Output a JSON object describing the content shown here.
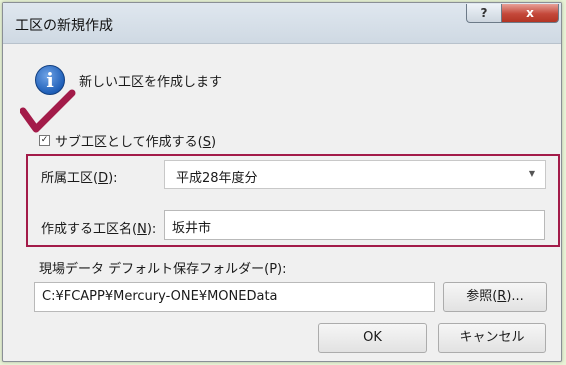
{
  "window": {
    "title": "工区の新規作成",
    "help_label": "?",
    "close_label": "x"
  },
  "info": {
    "icon_letter": "i",
    "message": "新しい工区を作成します"
  },
  "subtask_checkbox": {
    "prefix": "サブ工区として作成する(",
    "key": "S",
    "suffix": ")",
    "checked_glyph": "✓"
  },
  "parent_section": {
    "prefix": "所属工区(",
    "key": "D",
    "suffix": "):",
    "value": "平成28年度分",
    "arrow": "▼"
  },
  "section_name": {
    "prefix": "作成する工区名(",
    "key": "N",
    "suffix": "):",
    "value": "坂井市"
  },
  "default_folder": {
    "label": "現場データ デフォルト保存フォルダー(P):",
    "path": "C:¥FCAPP¥Mercury-ONE¥MONEData"
  },
  "browse_button": {
    "prefix": "参照(",
    "key": "R",
    "suffix": ")..."
  },
  "ok_button": {
    "label": "OK"
  },
  "cancel_button": {
    "label": "キャンセル"
  },
  "accent_colors": {
    "highlight_frame": "#a31b49",
    "checkmark": "#a31b49",
    "close_button": "#c4483a"
  }
}
